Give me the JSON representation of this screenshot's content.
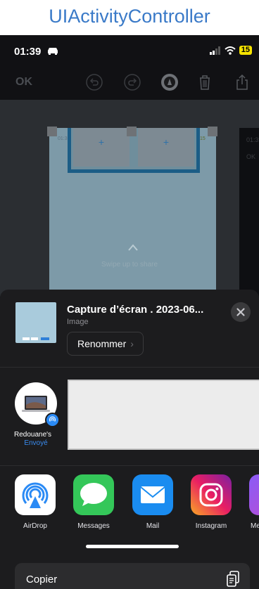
{
  "page": {
    "title": "UIActivityController"
  },
  "status_bar": {
    "time": "01:39",
    "battery": "15"
  },
  "toolbar": {
    "ok_label": "OK"
  },
  "preview": {
    "swipe_hint": "Swipe up to share",
    "mini_time": "01:3",
    "mini_battery": "15",
    "side_time": "01:3",
    "side_ok": "OK"
  },
  "share_sheet": {
    "file_title": "Capture d’écran . 2023-06...",
    "file_type": "Image",
    "rename_label": "Renommer",
    "person": {
      "name": "Redouane's",
      "status": "Envoyé"
    },
    "apps": [
      {
        "label": "AirDrop",
        "icon": "airdrop-icon",
        "color": "#ffffff"
      },
      {
        "label": "Messages",
        "icon": "messages-icon",
        "color": "#34c759"
      },
      {
        "label": "Mail",
        "icon": "mail-icon",
        "color": "#1a8cf0"
      },
      {
        "label": "Instagram",
        "icon": "instagram-icon",
        "color": "#d62976"
      },
      {
        "label": "Me",
        "icon": "more-app-icon",
        "color": "#8a5cf6"
      }
    ],
    "copy_label": "Copier"
  },
  "colors": {
    "accent": "#3a7ac8",
    "sheet_bg": "#1c1c1e",
    "sent_blue": "#3a8cf0",
    "battery": "#f5e300"
  }
}
